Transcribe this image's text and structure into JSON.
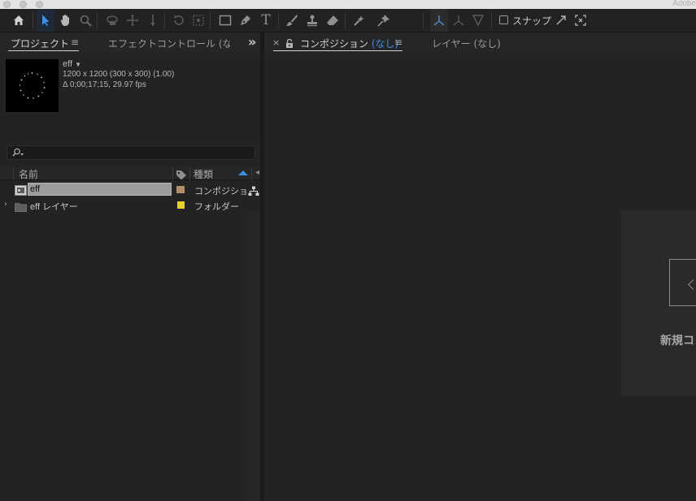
{
  "window": {
    "app_title": "Adobe"
  },
  "toolbar": {
    "tools": [
      "home-icon",
      "selection-icon",
      "hand-icon",
      "zoom-icon",
      "rotate-camera-icon",
      "pan-camera-icon",
      "dolly-camera-icon",
      "rotate-icon",
      "pan-behind-icon",
      "rectangle-icon",
      "pen-icon",
      "type-icon",
      "brush-icon",
      "clone-stamp-icon",
      "eraser-icon",
      "roto-brush-icon",
      "puppet-pin-icon",
      "local-axis-icon",
      "world-axis-icon",
      "view-axis-icon",
      "snap-expand-icon",
      "snap-fit-icon"
    ],
    "snap_label": "スナップ"
  },
  "left_panel": {
    "tabs": [
      {
        "label": "プロジェクト",
        "active": true
      },
      {
        "label": "エフェクトコントロール (なし",
        "active": false
      }
    ],
    "overflow_label": "»",
    "preview": {
      "name": "eff",
      "dims": "1200 x 1200  (300 x 300) (1.00)",
      "duration": "Δ 0;00;17;15, 29.97 fps"
    },
    "search_icon": "search-icon",
    "columns": {
      "name": "名前",
      "label": "label-tag-icon",
      "type": "種類"
    },
    "rows": [
      {
        "name": "eff",
        "type": "コンポジション",
        "label_color": "#b38e6b",
        "selected": true
      },
      {
        "name": "eff レイヤー",
        "type": "フォルダー",
        "label_color": "#e7d12f",
        "selected": false
      }
    ]
  },
  "right_panel": {
    "tabs": [
      {
        "label": "コンポジション",
        "qualifier": "(なし)",
        "active": true
      },
      {
        "label": "レイヤー (なし)",
        "active": false
      }
    ],
    "close_label": "×",
    "new_comp_text": "新規コン"
  },
  "colors": {
    "accent": "#3f8ee5",
    "panel_bg": "#232323",
    "selection": "#9b9b9b"
  }
}
